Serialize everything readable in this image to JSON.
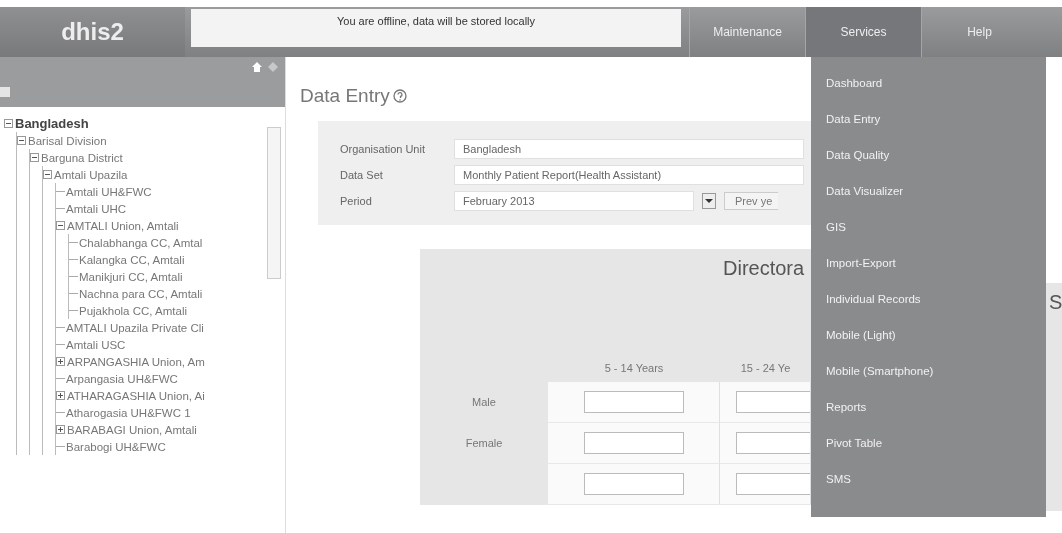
{
  "header": {
    "logo": "dhis2",
    "notice": "You are offline, data will be stored locally",
    "nav": [
      {
        "label": "Maintenance",
        "selected": false
      },
      {
        "label": "Services",
        "selected": true
      },
      {
        "label": "Help",
        "selected": false
      }
    ]
  },
  "tree": [
    {
      "label": "Bangladesh",
      "expanded": true,
      "children": [
        {
          "label": "Barisal Division",
          "expanded": true,
          "children": [
            {
              "label": "Barguna District",
              "expanded": true,
              "children": [
                {
                  "label": "Amtali Upazila",
                  "expanded": true,
                  "children": [
                    {
                      "label": "Amtali UH&FWC"
                    },
                    {
                      "label": "Amtali UHC"
                    },
                    {
                      "label": "AMTALI Union, Amtali",
                      "expanded": true,
                      "children": [
                        {
                          "label": "Chalabhanga CC, Amtal"
                        },
                        {
                          "label": "Kalangka CC, Amtali"
                        },
                        {
                          "label": "Manikjuri CC, Amtali"
                        },
                        {
                          "label": "Nachna para CC, Amtali"
                        },
                        {
                          "label": "Pujakhola CC, Amtali"
                        }
                      ]
                    },
                    {
                      "label": "AMTALI Upazila Private Cli"
                    },
                    {
                      "label": "Amtali USC"
                    },
                    {
                      "label": "ARPANGASHIA Union, Am",
                      "expanded": false
                    },
                    {
                      "label": "Arpangasia UH&FWC"
                    },
                    {
                      "label": "ATHARAGASHIA Union, Ai",
                      "expanded": false
                    },
                    {
                      "label": "Atharogasia UH&FWC 1"
                    },
                    {
                      "label": "BARABAGI Union, Amtali",
                      "expanded": false
                    },
                    {
                      "label": "Barabogi UH&FWC"
                    }
                  ]
                }
              ]
            }
          ]
        }
      ]
    }
  ],
  "page": {
    "title": "Data Entry"
  },
  "form": [
    {
      "label": "Organisation Unit",
      "value": "Bangladesh",
      "kind": "text"
    },
    {
      "label": "Data Set",
      "value": "Monthly Patient Report(Health Assistant)",
      "kind": "text"
    },
    {
      "label": "Period",
      "value": "February 2013",
      "kind": "period",
      "buttons": [
        "Prev ye"
      ]
    }
  ],
  "report": {
    "title": "Directora",
    "title_end": "S",
    "columns": [
      "5 - 14 Years",
      "15 - 24 Ye"
    ],
    "rows": [
      "Male",
      "Female",
      ""
    ]
  },
  "services_menu": [
    "Dashboard",
    "Data Entry",
    "Data Quality",
    "Data Visualizer",
    "GIS",
    "Import-Export",
    "Individual Records",
    "Mobile (Light)",
    "Mobile (Smartphone)",
    "Reports",
    "Pivot Table",
    "SMS"
  ]
}
